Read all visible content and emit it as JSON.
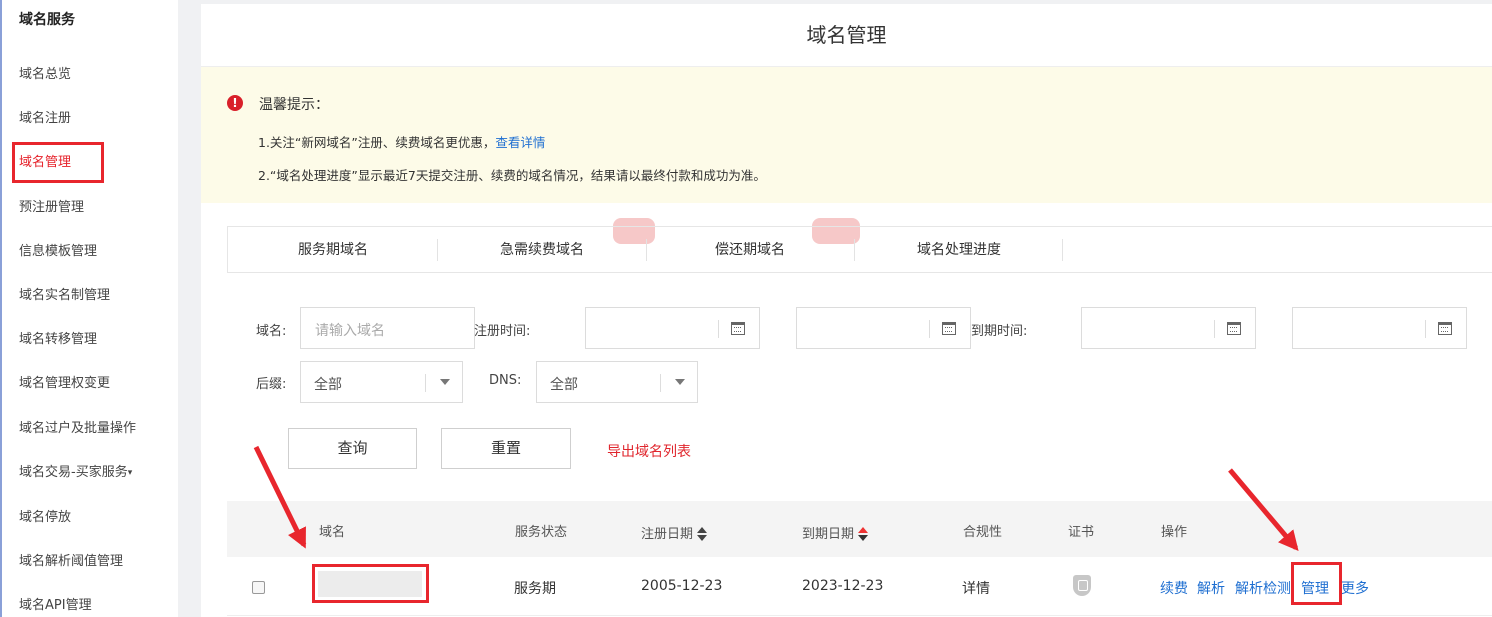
{
  "sidebar": {
    "title": "域名服务",
    "items": [
      {
        "label": "域名总览"
      },
      {
        "label": "域名注册"
      },
      {
        "label": "域名管理"
      },
      {
        "label": "预注册管理"
      },
      {
        "label": "信息模板管理"
      },
      {
        "label": "域名实名制管理"
      },
      {
        "label": "域名转移管理"
      },
      {
        "label": "域名管理权变更"
      },
      {
        "label": "域名过户及批量操作"
      },
      {
        "label": "域名交易-买家服务"
      },
      {
        "label": "域名停放"
      },
      {
        "label": "域名解析阈值管理"
      },
      {
        "label": "域名API管理"
      }
    ],
    "caret_glyph": "▾"
  },
  "page": {
    "title": "域名管理"
  },
  "notice": {
    "title": "温馨提示：",
    "line1_text": "1.关注“新网域名”注册、续费域名更优惠，",
    "line1_link": "查看详情",
    "line2_text": "2.“域名处理进度”显示最近7天提交注册、续费的域名情况，结果请以最终付款和成功为准。",
    "icon_glyph": "!"
  },
  "tabs": [
    {
      "label": "服务期域名"
    },
    {
      "label": "急需续费域名"
    },
    {
      "label": "偿还期域名"
    },
    {
      "label": "域名处理进度"
    }
  ],
  "filters": {
    "domain_label": "域名:",
    "domain_placeholder": "请输入域名",
    "reg_time_label": "注册时间:",
    "expire_time_label": "到期时间:",
    "suffix_label": "后缀:",
    "suffix_value": "全部",
    "dns_label": "DNS:",
    "dns_value": "全部"
  },
  "actions": {
    "query": "查询",
    "reset": "重置",
    "export": "导出域名列表"
  },
  "table": {
    "headers": {
      "domain": "域名",
      "status": "服务状态",
      "reg_date": "注册日期",
      "expire_date": "到期日期",
      "compliance": "合规性",
      "certificate": "证书",
      "operations": "操作"
    },
    "rows": [
      {
        "status": "服务期",
        "reg_date": "2005-12-23",
        "expire_date": "2023-12-23",
        "compliance": "详情",
        "ops": [
          "续费",
          "解析",
          "解析检测",
          "管理",
          "更多"
        ]
      }
    ]
  },
  "colors": {
    "accent_red": "#e6212a",
    "link_blue": "#1f6fd1",
    "notice_bg": "#fdfbe8"
  }
}
